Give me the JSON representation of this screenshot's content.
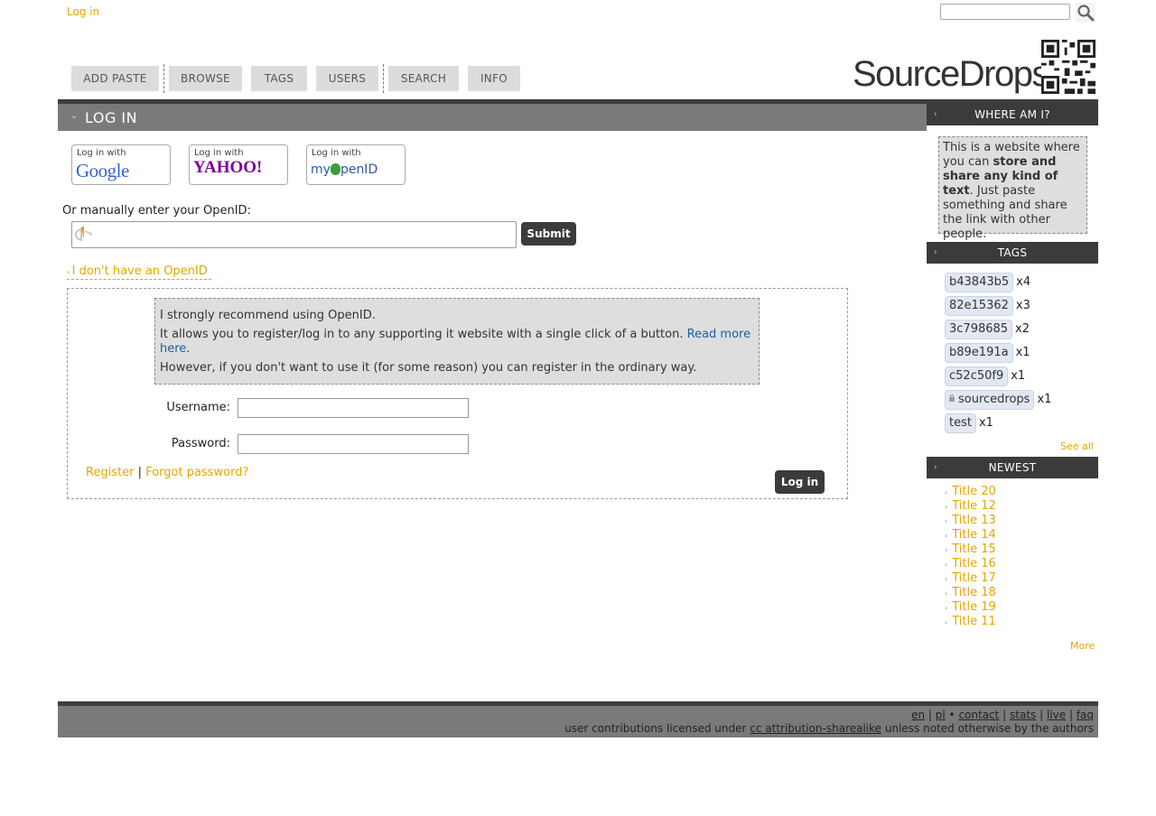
{
  "top": {
    "login_link": "Log in",
    "search_placeholder": ""
  },
  "nav": [
    "ADD PASTE",
    "BROWSE",
    "TAGS",
    "USERS",
    "SEARCH",
    "INFO"
  ],
  "logo": {
    "text": "SourceDrops"
  },
  "main": {
    "title": "LOG IN",
    "providers": {
      "login_with": "Log in with",
      "google": "Google",
      "yahoo": "YAHOO!",
      "myopenid_prefix": "my",
      "myopenid_suffix": "penID"
    },
    "openid_label": "Or manually enter your OpenID:",
    "submit": "Submit",
    "no_openid": "I don't have an OpenID",
    "info": {
      "line1": "I strongly recommend using OpenID.",
      "line2": "It allows you to register/log in to any supporting it website with a single click of a button.",
      "read_more_1": "Read more",
      "read_more_2": "here",
      "line3": "However, if you don't want to use it (for some reason) you can register in the ordinary way."
    },
    "username_label": "Username:",
    "password_label": "Password:",
    "register": "Register",
    "separator": "|",
    "forgot": "Forgot password?",
    "login_button": "Log in"
  },
  "sidebar": {
    "where_title": "WHERE AM I?",
    "where_1": "This is a website where you can",
    "where_bold": "store and share any kind of text",
    "where_2": ". Just paste something and share the link with other people.",
    "tags_title": "TAGS",
    "tags": [
      {
        "name": "b43843b5",
        "count": "x4"
      },
      {
        "name": "82e15362",
        "count": "x3"
      },
      {
        "name": "3c798685",
        "count": "x2"
      },
      {
        "name": "b89e191a",
        "count": "x1"
      },
      {
        "name": "c52c50f9",
        "count": "x1"
      },
      {
        "name": "sourcedrops",
        "count": "x1"
      },
      {
        "name": "test",
        "count": "x1"
      }
    ],
    "see_all": "See all",
    "newest_title": "NEWEST",
    "newest": [
      "Title 20",
      "Title 12",
      "Title 13",
      "Title 14",
      "Title 15",
      "Title 16",
      "Title 17",
      "Title 18",
      "Title 19",
      "Title 11"
    ],
    "more": "More"
  },
  "footer": {
    "en": "en",
    "pl": "pl",
    "contact": "contact",
    "stats": "stats",
    "live": "live",
    "faq": "faq",
    "license_pre": "user contributions licensed under",
    "license_link": "cc attribution-sharealike",
    "license_post": "unless noted otherwise by the authors"
  },
  "colors": {
    "accent": "#e6a400",
    "link_blue": "#1f5fa6",
    "header_gray": "#7a7a7a",
    "dark_bar": "#3b3b3b"
  }
}
